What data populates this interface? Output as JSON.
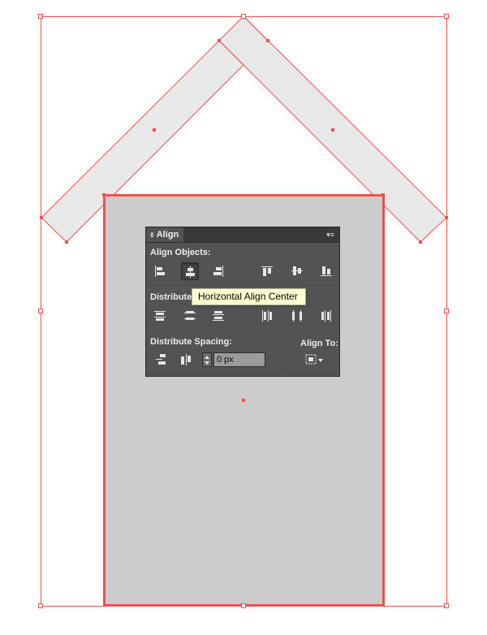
{
  "colors": {
    "selection": "#f05050",
    "roof_fill": "#e8e8e8",
    "body_fill": "#cccccc",
    "panel_bg": "#535353",
    "tooltip_bg": "#ffffd2"
  },
  "panel": {
    "title": "Align",
    "align_objects_label": "Align Objects:",
    "distribute_objects_label": "Distribute",
    "distribute_spacing_label": "Distribute Spacing:",
    "align_to_label": "Align To:",
    "spacing_value": "0 px",
    "align_objects_icons": [
      "horizontal-align-left-icon",
      "horizontal-align-center-icon",
      "horizontal-align-right-icon",
      "vertical-align-top-icon",
      "vertical-align-center-icon",
      "vertical-align-bottom-icon"
    ],
    "pressed_icon": "horizontal-align-center-icon"
  },
  "tooltip": {
    "text": "Horizontal Align Center"
  }
}
